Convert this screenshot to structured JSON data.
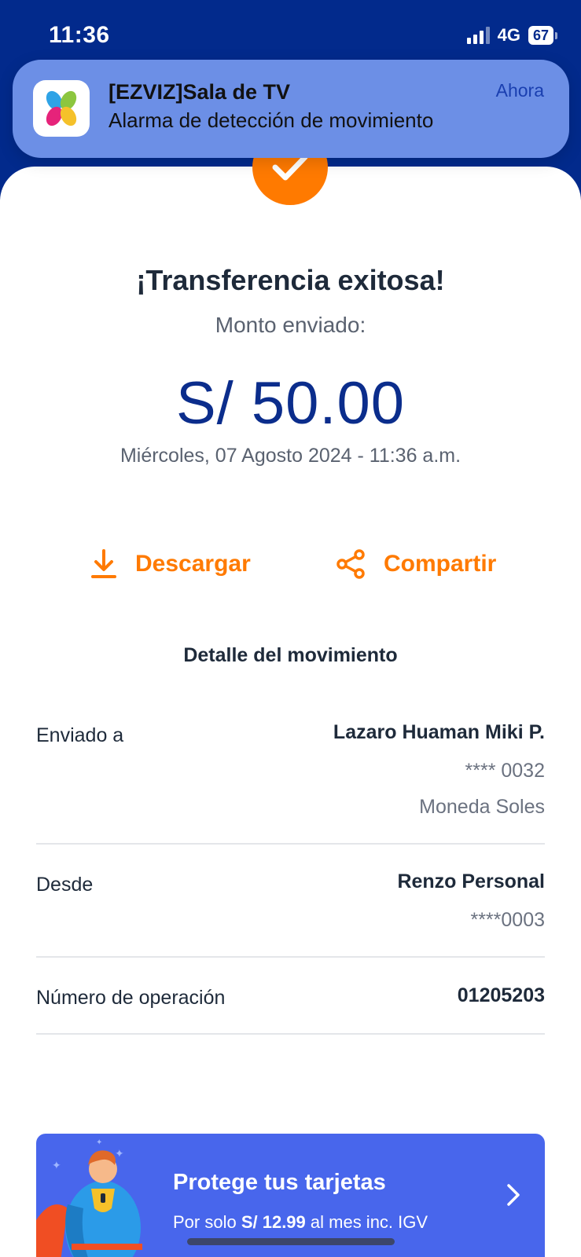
{
  "status_bar": {
    "time": "11:36",
    "network": "4G",
    "battery": "67"
  },
  "notification": {
    "title": "[EZVIZ]Sala de TV",
    "body": "Alarma de detección de movimiento",
    "time": "Ahora",
    "app_icon": "ezviz-app-icon"
  },
  "transfer": {
    "title": "¡Transferencia exitosa!",
    "amount_label": "Monto enviado:",
    "amount": "S/ 50.00",
    "datetime": "Miércoles, 07 Agosto 2024 - 11:36 a.m."
  },
  "actions": {
    "download": "Descargar",
    "share": "Compartir"
  },
  "detail": {
    "section_title": "Detalle del movimiento",
    "sent_to_label": "Enviado a",
    "sent_to_name": "Lazaro Huaman Miki P.",
    "sent_to_account": "**** 0032",
    "sent_to_currency": "Moneda Soles",
    "from_label": "Desde",
    "from_name": "Renzo Personal",
    "from_account": "****0003",
    "operation_label": "Número de operación",
    "operation_number": "01205203"
  },
  "promo": {
    "title": "Protege tus tarjetas",
    "sub_prefix": "Por solo ",
    "sub_price": "S/ 12.99",
    "sub_suffix": " al mes inc. IGV"
  },
  "colors": {
    "brand_blue": "#022a8c",
    "accent_orange": "#ff7a00",
    "promo_blue": "#4866ec"
  }
}
